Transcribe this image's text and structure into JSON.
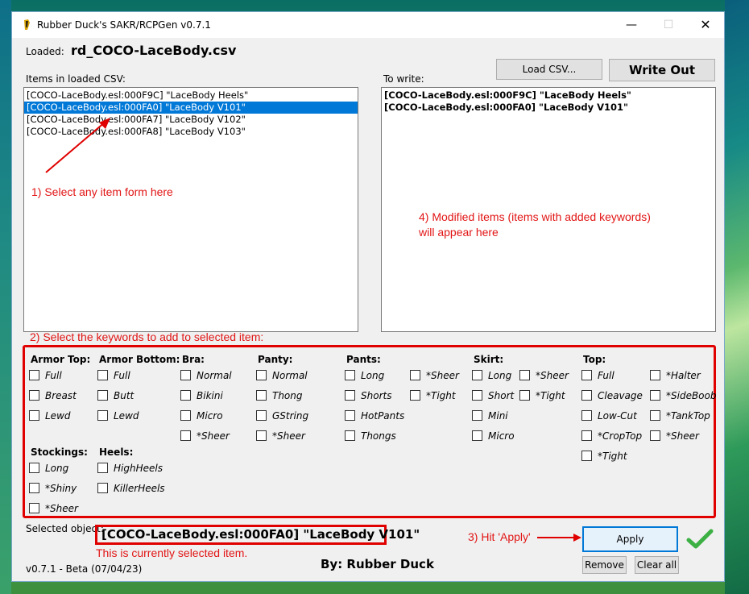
{
  "window": {
    "title": "Rubber Duck's SAKR/RCPGen v0.7.1",
    "controls": {
      "minimize": "—",
      "maximize": "☐",
      "close": "✕"
    }
  },
  "loaded": {
    "label": "Loaded:",
    "filename": "rd_COCO-LaceBody.csv"
  },
  "buttons": {
    "load_csv": "Load CSV...",
    "write_out": "Write Out",
    "apply": "Apply",
    "remove": "Remove",
    "clear_all": "Clear all"
  },
  "items_panel": {
    "label": "Items in loaded CSV:",
    "items": [
      "[COCO-LaceBody.esl:000F9C] \"LaceBody Heels\"",
      "[COCO-LaceBody.esl:000FA0] \"LaceBody V101\"",
      "[COCO-LaceBody.esl:000FA7] \"LaceBody V102\"",
      "[COCO-LaceBody.esl:000FA8] \"LaceBody V103\""
    ],
    "selected_index": 1
  },
  "write_panel": {
    "label": "To write:",
    "items": [
      "[COCO-LaceBody.esl:000F9C] \"LaceBody Heels\"",
      "[COCO-LaceBody.esl:000FA0] \"LaceBody V101\""
    ]
  },
  "annotations": {
    "step1": "1) Select any item form here",
    "step2": "2) Select the keywords to add to selected item:",
    "step3": "3) Hit 'Apply'",
    "step4_line1": "4) Modified items (items with added keywords)",
    "step4_line2": "will appear here",
    "selected_note": "This is currently selected item."
  },
  "keywords": {
    "armor_top": {
      "label": "Armor Top:",
      "options": [
        "Full",
        "Breast",
        "Lewd"
      ]
    },
    "armor_bottom": {
      "label": "Armor Bottom:",
      "options": [
        "Full",
        "Butt",
        "Lewd"
      ]
    },
    "bra": {
      "label": "Bra:",
      "options": [
        "Normal",
        "Bikini",
        "Micro",
        "*Sheer"
      ]
    },
    "panty": {
      "label": "Panty:",
      "options": [
        "Normal",
        "Thong",
        "GString",
        "*Sheer"
      ]
    },
    "pants": {
      "label": "Pants:",
      "options": [
        "Long",
        "Shorts",
        "HotPants",
        "Thongs"
      ],
      "extra": [
        "*Sheer",
        "*Tight"
      ]
    },
    "skirt": {
      "label": "Skirt:",
      "options": [
        "Long",
        "Short",
        "Mini",
        "Micro"
      ],
      "extra": [
        "*Sheer",
        "*Tight"
      ]
    },
    "top": {
      "label": "Top:",
      "options": [
        "Full",
        "Cleavage",
        "Low-Cut",
        "*CropTop",
        "*Tight"
      ],
      "extra": [
        "*Halter",
        "*SideBoob",
        "*TankTop",
        "*Sheer"
      ]
    },
    "stockings": {
      "label": "Stockings:",
      "options": [
        "Long",
        "*Shiny",
        "*Sheer"
      ]
    },
    "heels": {
      "label": "Heels:",
      "options": [
        "HighHeels",
        "KillerHeels"
      ]
    }
  },
  "selected_object": {
    "label": "Selected object:",
    "value": "[COCO-LaceBody.esl:000FA0] \"LaceBody V101\""
  },
  "footer": {
    "version": "v0.7.1 - Beta (07/04/23)",
    "author": "By: Rubber Duck"
  },
  "colors": {
    "accent": "#0078d7",
    "annotation": "#e21515",
    "success": "#3cb043"
  }
}
